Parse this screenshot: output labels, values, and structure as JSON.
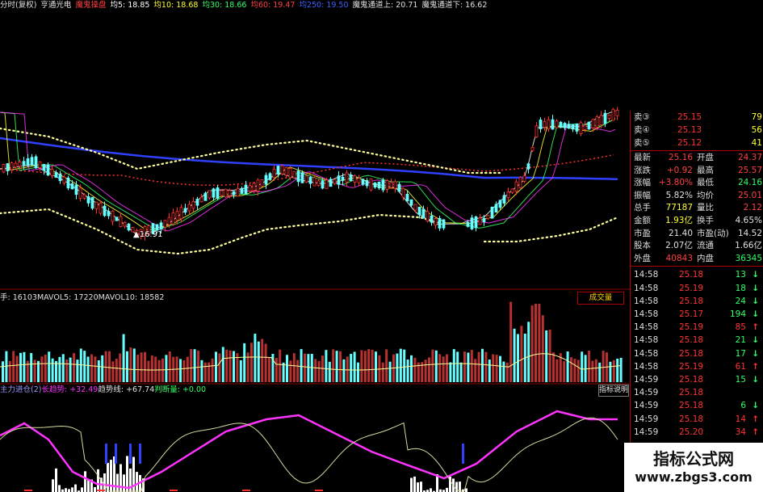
{
  "header": {
    "items": [
      {
        "text": "分时(复权)",
        "color": "#e0e0e0"
      },
      {
        "text": "亨通光电",
        "color": "#e0e0e0"
      },
      {
        "text": "魔鬼操盘",
        "color": "#ff4040"
      },
      {
        "text": "均5: 18.85",
        "color": "#ffffff"
      },
      {
        "text": "均10: 18.68",
        "color": "#ffff33"
      },
      {
        "text": "均30: 18.66",
        "color": "#33ff66"
      },
      {
        "text": "均60: 19.47",
        "color": "#ff4040"
      },
      {
        "text": "均250: 19.50",
        "color": "#4060ff"
      },
      {
        "text": "魔鬼通道上: 20.71",
        "color": "#e0e0e0"
      },
      {
        "text": "魔鬼通道下: 16.62",
        "color": "#e0e0e0"
      }
    ]
  },
  "price_chart": {
    "low_marker": "16.91"
  },
  "volume": {
    "header": [
      {
        "text": "手: 16103",
        "color": "#e0e0e0"
      },
      {
        "text": "MAVOL5: 17220",
        "color": "#e0e0e0"
      },
      {
        "text": "MAVOL10: 18582",
        "color": "#e0e0e0"
      }
    ],
    "button": "成交量"
  },
  "indicator": {
    "header": [
      {
        "text": "主力进仓(2)",
        "color": "#9999ff"
      },
      {
        "text": "长趋势: +32.49",
        "color": "#ff33ff"
      },
      {
        "text": "趋势线: +67.74",
        "color": "#e0e0e0"
      },
      {
        "text": "判断量: +0.00",
        "color": "#33ff66"
      }
    ],
    "button": "指标说明"
  },
  "quotes": {
    "asks": [
      {
        "label": "卖③",
        "price": "25.15",
        "vol": "79"
      },
      {
        "label": "卖④",
        "price": "25.13",
        "vol": "56"
      },
      {
        "label": "卖⑤",
        "price": "25.12",
        "vol": "41"
      }
    ],
    "stats": [
      {
        "l1": "最新",
        "v1": "25.16",
        "c1": "#ff4040",
        "l2": "开盘",
        "v2": "24.37",
        "c2": "#ff4040"
      },
      {
        "l1": "涨跌",
        "v1": "+0.92",
        "c1": "#ff4040",
        "l2": "最高",
        "v2": "25.57",
        "c2": "#ff4040"
      },
      {
        "l1": "涨幅",
        "v1": "+3.80%",
        "c1": "#ff4040",
        "l2": "最低",
        "v2": "24.16",
        "c2": "#33ff66"
      },
      {
        "l1": "振幅",
        "v1": "5.82%",
        "c1": "#e0e0e0",
        "l2": "均价",
        "v2": "25.01",
        "c2": "#ff4040"
      },
      {
        "l1": "总手",
        "v1": "77187",
        "c1": "#ffff33",
        "l2": "量比",
        "v2": "2.12",
        "c2": "#ff4040"
      },
      {
        "l1": "金额",
        "v1": "1.93亿",
        "c1": "#ffff33",
        "l2": "换手",
        "v2": "4.65%",
        "c2": "#e0e0e0"
      },
      {
        "l1": "市盈",
        "v1": "21.40",
        "c1": "#e0e0e0",
        "l2": "市盈(动)",
        "v2": "14.52",
        "c2": "#e0e0e0"
      },
      {
        "l1": "股本",
        "v1": "2.07亿",
        "c1": "#e0e0e0",
        "l2": "流通",
        "v2": "1.66亿",
        "c2": "#e0e0e0"
      },
      {
        "l1": "外盘",
        "v1": "40843",
        "c1": "#ff4040",
        "l2": "内盘",
        "v2": "36345",
        "c2": "#33ff66"
      }
    ],
    "ticks": [
      {
        "time": "14:58",
        "price": "25.18",
        "vol": "13",
        "dir": "down"
      },
      {
        "time": "14:58",
        "price": "25.19",
        "vol": "18",
        "dir": "down"
      },
      {
        "time": "14:58",
        "price": "25.18",
        "vol": "24",
        "dir": "down"
      },
      {
        "time": "14:58",
        "price": "25.17",
        "vol": "194",
        "dir": "down"
      },
      {
        "time": "14:58",
        "price": "25.19",
        "vol": "85",
        "dir": "up"
      },
      {
        "time": "14:58",
        "price": "25.18",
        "vol": "21",
        "dir": "down"
      },
      {
        "time": "14:58",
        "price": "25.18",
        "vol": "17",
        "dir": "down"
      },
      {
        "time": "14:58",
        "price": "25.19",
        "vol": "61",
        "dir": "up"
      },
      {
        "time": "14:59",
        "price": "25.18",
        "vol": "15",
        "dir": "down"
      },
      {
        "time": "14:59",
        "price": "25.18",
        "vol": "",
        "dir": "none"
      },
      {
        "time": "14:59",
        "price": "25.18",
        "vol": "6",
        "dir": "down"
      },
      {
        "time": "14:59",
        "price": "25.18",
        "vol": "14",
        "dir": "up"
      },
      {
        "time": "14:59",
        "price": "25.20",
        "vol": "34",
        "dir": "up"
      }
    ]
  },
  "watermark": {
    "line1": "指标公式网",
    "line2": "www.zbgs3.com"
  },
  "colors": {
    "up": "#ff3333",
    "down": "#33ff66",
    "neutral": "#e0e0e0",
    "volume_up": "#b83030",
    "volume_down": "#66ffff",
    "ma250": "#3040ff",
    "ma60": "#ff3030",
    "channel": "#ffff99",
    "indicator_trend": "#ff33ff"
  }
}
